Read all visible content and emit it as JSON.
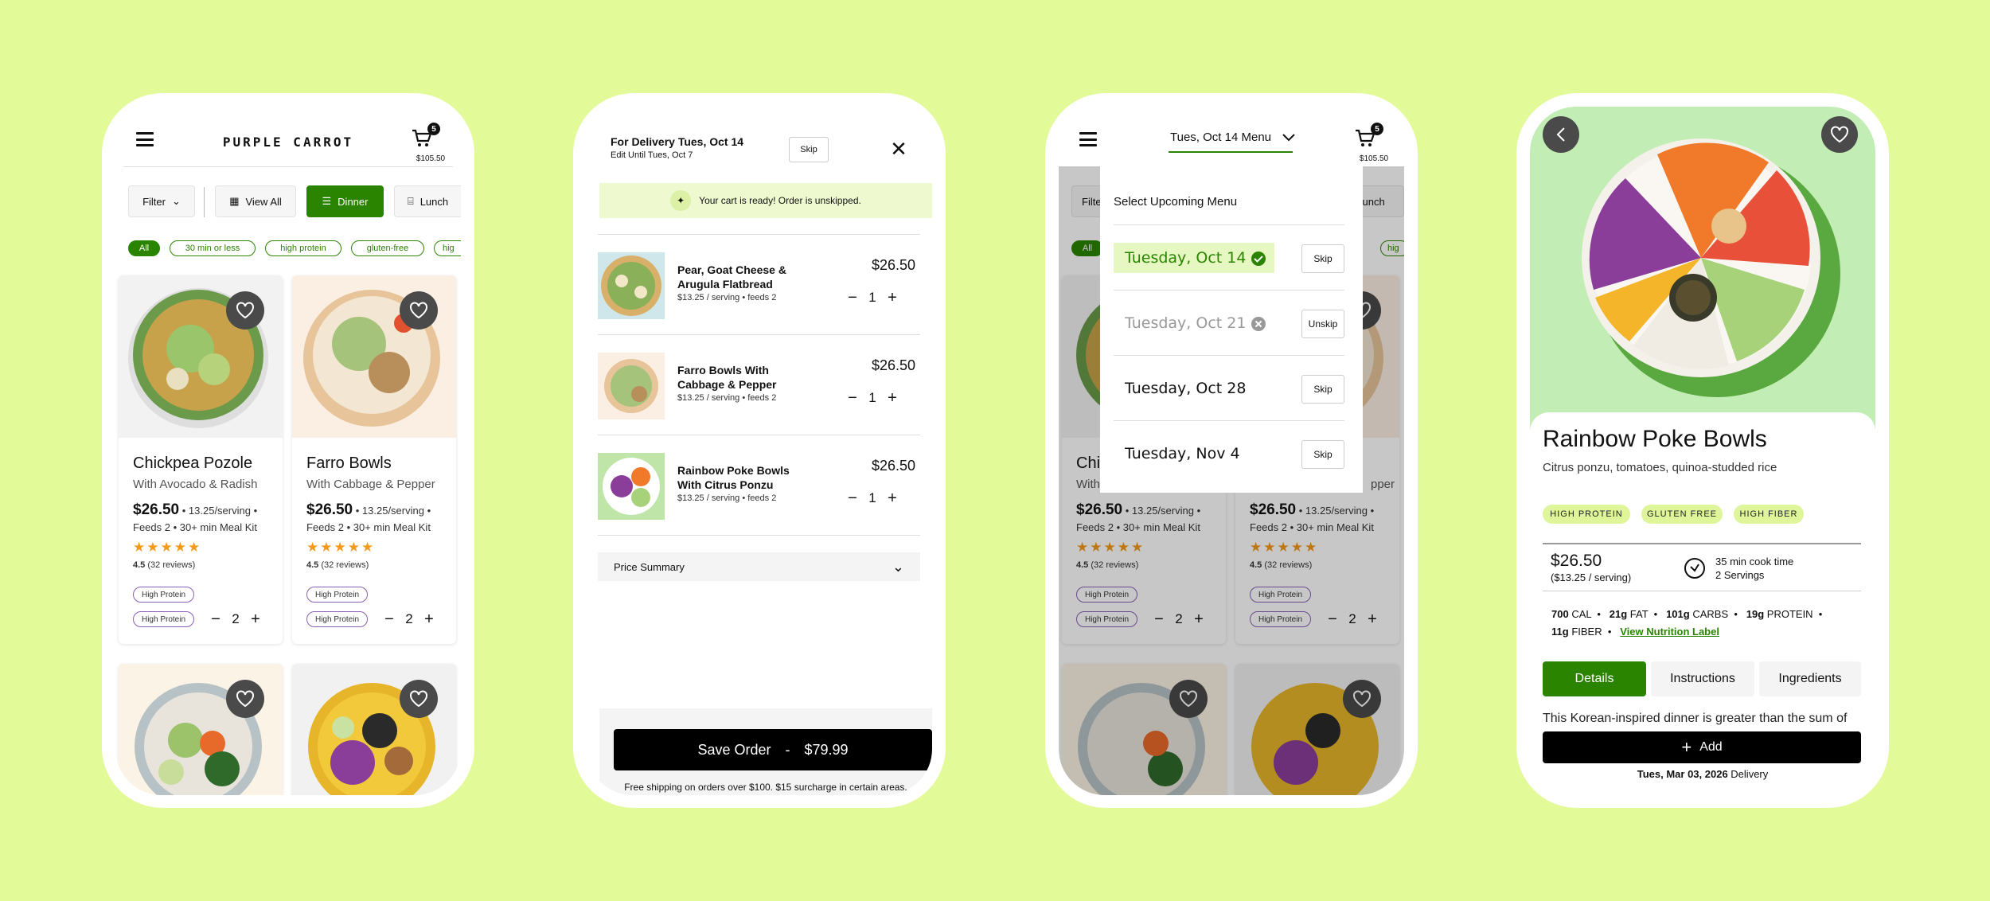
{
  "phone1": {
    "brand": "PURPLE CARROT",
    "cart_count": "5",
    "cart_total": "$105.50",
    "filter_label": "Filter",
    "view_all_label": "View All",
    "dinner_label": "Dinner",
    "lunch_label": "Lunch",
    "chips": [
      "All",
      "30 min or less",
      "high protein",
      "gluten-free",
      "hig"
    ],
    "cards": [
      {
        "name": "Chickpea Pozole",
        "sub": "With Avocado & Radish",
        "price": "$26.50",
        "per": "• 13.25/serving •",
        "kit": "Feeds 2 • 30+ min Meal Kit",
        "stars": "★★★★★",
        "rating": "4.5",
        "reviews": "(32 reviews)",
        "tag1": "High Protein",
        "tag2": "High Protein",
        "qty": "2"
      },
      {
        "name": "Farro Bowls",
        "sub": "With Cabbage & Pepper",
        "price": "$26.50",
        "per": "• 13.25/serving •",
        "kit": "Feeds 2 • 30+ min Meal Kit",
        "stars": "★★★★★",
        "rating": "4.5",
        "reviews": "(32 reviews)",
        "tag1": "High Protein",
        "tag2": "High Protein",
        "qty": "2"
      }
    ]
  },
  "phone2": {
    "delivery_title": "For Delivery Tues, Oct 14",
    "edit_until": "Edit Until Tues, Oct 7",
    "skip_label": "Skip",
    "banner": "Your cart is ready! Order is unskipped.",
    "items": [
      {
        "title": "Pear, Goat Cheese & Arugula Flatbread",
        "sub": "$13.25 / serving • feeds 2",
        "price": "$26.50",
        "qty": "1"
      },
      {
        "title": "Farro Bowls With Cabbage & Pepper",
        "sub": "$13.25 / serving • feeds 2",
        "price": "$26.50",
        "qty": "1"
      },
      {
        "title": "Rainbow Poke Bowls With Citrus Ponzu",
        "sub": "$13.25 / serving • feeds 2",
        "price": "$26.50",
        "qty": "1"
      }
    ],
    "price_summary": "Price Summary",
    "save_label": "Save Order",
    "save_sep": "-",
    "save_total": "$79.99",
    "shipping_note": "Free shipping on orders over $100. $15 surcharge in certain areas."
  },
  "phone3": {
    "menu_title": "Tues, Oct 14 Menu",
    "cart_count": "5",
    "cart_total": "$105.50",
    "dropdown_heading": "Select Upcoming Menu",
    "rows": [
      {
        "date": "Tuesday, Oct 14",
        "action": "Skip"
      },
      {
        "date": "Tuesday, Oct 21",
        "action": "Unskip"
      },
      {
        "date": "Tuesday, Oct 28",
        "action": "Skip"
      },
      {
        "date": "Tuesday, Nov 4",
        "action": "Skip"
      }
    ],
    "bg_filter": "Filte",
    "bg_lunch": "Lunch",
    "bg_chip_all": "All",
    "bg_chip_hig": "hig",
    "bg_name1": "Chi",
    "bg_sub1": "With",
    "bg_sub2": "pper",
    "bg_price": "$26.50",
    "bg_per": "• 13.25/serving •",
    "bg_kit": "Feeds 2 • 30+ min Meal Kit",
    "bg_stars": "★★★★★",
    "bg_rating": "4.5",
    "bg_reviews": "(32 reviews)",
    "bg_tag": "High Protein",
    "bg_qty": "2"
  },
  "phone4": {
    "title": "Rainbow Poke Bowls",
    "subtitle": "Citrus ponzu, tomatoes, quinoa-studded rice",
    "tags": [
      "HIGH PROTEIN",
      "GLUTEN FREE",
      "HIGH FIBER"
    ],
    "price": "$26.50",
    "per_serving": "($13.25 / serving)",
    "cook_time": "35 min cook time",
    "servings": "2 Servings",
    "cal": "700",
    "cal_unit": "CAL",
    "fat": "21g",
    "fat_unit": "FAT",
    "carbs": "101g",
    "carbs_unit": "CARBS",
    "protein": "19g",
    "protein_unit": "PROTEIN",
    "fiber": "11g",
    "fiber_unit": "FIBER",
    "nutrition_link": "View Nutrition Label",
    "tabs": [
      "Details",
      "Instructions",
      "Ingredients"
    ],
    "description": "This Korean-inspired dinner is greater than the sum of",
    "add_label": "Add",
    "delivery_date": "Tues, Mar 03, 2026",
    "delivery_word": "Delivery"
  },
  "colors": {
    "background": "#e3fa98",
    "brand_green": "#2a8400",
    "tag_green": "#dff59a",
    "star": "#f39a1b"
  }
}
